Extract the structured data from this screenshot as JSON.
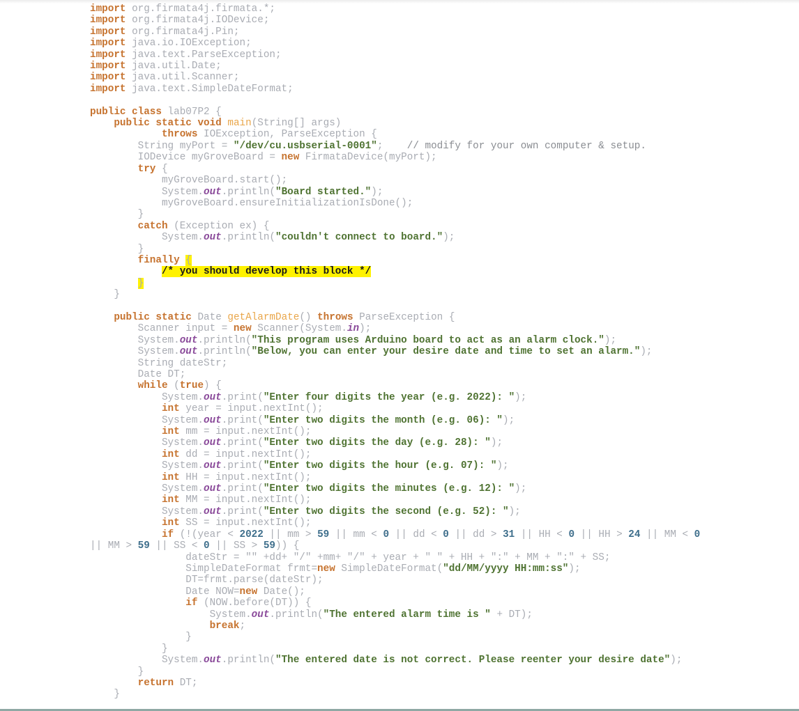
{
  "document": {
    "language": "java",
    "class_name": "lab07P2",
    "highlight_color": "#fff200",
    "colors": {
      "keyword": "#c6732f",
      "string": "#4f7332",
      "number": "#3f6f8c",
      "method_decl": "#e9a64a",
      "static_field": "#8a4a9a",
      "plain": "#a9acb3"
    }
  },
  "lines": [
    [
      [
        "kw",
        "import"
      ],
      [
        "p",
        " org.firmata4j.firmata.*;"
      ]
    ],
    [
      [
        "kw",
        "import"
      ],
      [
        "p",
        " org.firmata4j.IODevice;"
      ]
    ],
    [
      [
        "kw",
        "import"
      ],
      [
        "p",
        " org.firmata4j.Pin;"
      ]
    ],
    [
      [
        "kw",
        "import"
      ],
      [
        "p",
        " java.io.IOException;"
      ]
    ],
    [
      [
        "kw",
        "import"
      ],
      [
        "p",
        " java.text.ParseException;"
      ]
    ],
    [
      [
        "kw",
        "import"
      ],
      [
        "p",
        " java.util.Date;"
      ]
    ],
    [
      [
        "kw",
        "import"
      ],
      [
        "p",
        " java.util.Scanner;"
      ]
    ],
    [
      [
        "kw",
        "import"
      ],
      [
        "p",
        " java.text.SimpleDateFormat;"
      ]
    ],
    [],
    [
      [
        "kw",
        "public class"
      ],
      [
        "p",
        " lab07P2 {"
      ]
    ],
    [
      [
        "p",
        "    "
      ],
      [
        "kw",
        "public static void"
      ],
      [
        "p",
        " "
      ],
      [
        "fn",
        "main"
      ],
      [
        "p",
        "(String[] args)"
      ]
    ],
    [
      [
        "p",
        "            "
      ],
      [
        "kw",
        "throws"
      ],
      [
        "p",
        " IOException, ParseException {"
      ]
    ],
    [
      [
        "p",
        "        String myPort = "
      ],
      [
        "str",
        "\"/dev/cu.usbserial-0001\""
      ],
      [
        "p",
        ";    "
      ],
      [
        "cm",
        "// modify for your own computer & setup."
      ]
    ],
    [
      [
        "p",
        "        IODevice myGroveBoard = "
      ],
      [
        "kw",
        "new"
      ],
      [
        "p",
        " FirmataDevice(myPort);"
      ]
    ],
    [
      [
        "p",
        "        "
      ],
      [
        "kw",
        "try"
      ],
      [
        "p",
        " {"
      ]
    ],
    [
      [
        "p",
        "            myGroveBoard.start();"
      ]
    ],
    [
      [
        "p",
        "            System."
      ],
      [
        "field",
        "out"
      ],
      [
        "p",
        ".println("
      ],
      [
        "str",
        "\"Board started.\""
      ],
      [
        "p",
        ");"
      ]
    ],
    [
      [
        "p",
        "            myGroveBoard.ensureInitializationIsDone();"
      ]
    ],
    [
      [
        "p",
        "        }"
      ]
    ],
    [
      [
        "p",
        "        "
      ],
      [
        "kw",
        "catch"
      ],
      [
        "p",
        " (Exception ex) {"
      ]
    ],
    [
      [
        "p",
        "            System."
      ],
      [
        "field",
        "out"
      ],
      [
        "p",
        ".println("
      ],
      [
        "str",
        "\"couldn't connect to board.\""
      ],
      [
        "p",
        ");"
      ]
    ],
    [
      [
        "p",
        "        }"
      ]
    ],
    [
      [
        "p",
        "        "
      ],
      [
        "kw",
        "finally"
      ],
      [
        "p",
        " "
      ],
      [
        "hl",
        "{"
      ]
    ],
    [
      [
        "p",
        "            "
      ],
      [
        "hlcm",
        "/* you should develop this block */"
      ]
    ],
    [
      [
        "p",
        "        "
      ],
      [
        "hl",
        "}"
      ]
    ],
    [
      [
        "p",
        "    }"
      ]
    ],
    [],
    [
      [
        "p",
        "    "
      ],
      [
        "kw",
        "public static"
      ],
      [
        "p",
        " Date "
      ],
      [
        "fn",
        "getAlarmDate"
      ],
      [
        "p",
        "() "
      ],
      [
        "kw",
        "throws"
      ],
      [
        "p",
        " ParseException {"
      ]
    ],
    [
      [
        "p",
        "        Scanner input = "
      ],
      [
        "kw",
        "new"
      ],
      [
        "p",
        " Scanner(System."
      ],
      [
        "field",
        "in"
      ],
      [
        "p",
        ");"
      ]
    ],
    [
      [
        "p",
        "        System."
      ],
      [
        "field",
        "out"
      ],
      [
        "p",
        ".println("
      ],
      [
        "str",
        "\"This program uses Arduino board to act as an alarm clock.\""
      ],
      [
        "p",
        ");"
      ]
    ],
    [
      [
        "p",
        "        System."
      ],
      [
        "field",
        "out"
      ],
      [
        "p",
        ".println("
      ],
      [
        "str",
        "\"Below, you can enter your desire date and time to set an alarm.\""
      ],
      [
        "p",
        ");"
      ]
    ],
    [
      [
        "p",
        "        String dateStr;"
      ]
    ],
    [
      [
        "p",
        "        Date DT;"
      ]
    ],
    [
      [
        "p",
        "        "
      ],
      [
        "kw",
        "while"
      ],
      [
        "p",
        " ("
      ],
      [
        "kw",
        "true"
      ],
      [
        "p",
        ") {"
      ]
    ],
    [
      [
        "p",
        "            System."
      ],
      [
        "field",
        "out"
      ],
      [
        "p",
        ".print("
      ],
      [
        "str",
        "\"Enter four digits the year (e.g. 2022): \""
      ],
      [
        "p",
        ");"
      ]
    ],
    [
      [
        "p",
        "            "
      ],
      [
        "kw",
        "int"
      ],
      [
        "p",
        " year = input.nextInt();"
      ]
    ],
    [
      [
        "p",
        "            System."
      ],
      [
        "field",
        "out"
      ],
      [
        "p",
        ".print("
      ],
      [
        "str",
        "\"Enter two digits the month (e.g. 06): \""
      ],
      [
        "p",
        ");"
      ]
    ],
    [
      [
        "p",
        "            "
      ],
      [
        "kw",
        "int"
      ],
      [
        "p",
        " mm = input.nextInt();"
      ]
    ],
    [
      [
        "p",
        "            System."
      ],
      [
        "field",
        "out"
      ],
      [
        "p",
        ".print("
      ],
      [
        "str",
        "\"Enter two digits the day (e.g. 28): \""
      ],
      [
        "p",
        ");"
      ]
    ],
    [
      [
        "p",
        "            "
      ],
      [
        "kw",
        "int"
      ],
      [
        "p",
        " dd = input.nextInt();"
      ]
    ],
    [
      [
        "p",
        "            System."
      ],
      [
        "field",
        "out"
      ],
      [
        "p",
        ".print("
      ],
      [
        "str",
        "\"Enter two digits the hour (e.g. 07): \""
      ],
      [
        "p",
        ");"
      ]
    ],
    [
      [
        "p",
        "            "
      ],
      [
        "kw",
        "int"
      ],
      [
        "p",
        " HH = input.nextInt();"
      ]
    ],
    [
      [
        "p",
        "            System."
      ],
      [
        "field",
        "out"
      ],
      [
        "p",
        ".print("
      ],
      [
        "str",
        "\"Enter two digits the minutes (e.g. 12): \""
      ],
      [
        "p",
        ");"
      ]
    ],
    [
      [
        "p",
        "            "
      ],
      [
        "kw",
        "int"
      ],
      [
        "p",
        " MM = input.nextInt();"
      ]
    ],
    [
      [
        "p",
        "            System."
      ],
      [
        "field",
        "out"
      ],
      [
        "p",
        ".print("
      ],
      [
        "str",
        "\"Enter two digits the second (e.g. 52): \""
      ],
      [
        "p",
        ");"
      ]
    ],
    [
      [
        "p",
        "            "
      ],
      [
        "kw",
        "int"
      ],
      [
        "p",
        " SS = input.nextInt();"
      ]
    ],
    [
      [
        "p",
        "            "
      ],
      [
        "kw",
        "if"
      ],
      [
        "p",
        " (!(year < "
      ],
      [
        "num",
        "2022"
      ],
      [
        "p",
        " || mm > "
      ],
      [
        "num",
        "59"
      ],
      [
        "p",
        " || mm < "
      ],
      [
        "num",
        "0"
      ],
      [
        "p",
        " || dd < "
      ],
      [
        "num",
        "0"
      ],
      [
        "p",
        " || dd > "
      ],
      [
        "num",
        "31"
      ],
      [
        "p",
        " || HH < "
      ],
      [
        "num",
        "0"
      ],
      [
        "p",
        " || HH > "
      ],
      [
        "num",
        "24"
      ],
      [
        "p",
        " || MM < "
      ],
      [
        "num",
        "0"
      ]
    ],
    [
      [
        "p",
        "|| MM > "
      ],
      [
        "num",
        "59"
      ],
      [
        "p",
        " || SS < "
      ],
      [
        "num",
        "0"
      ],
      [
        "p",
        " || SS > "
      ],
      [
        "num",
        "59"
      ],
      [
        "p",
        ")) {"
      ]
    ],
    [
      [
        "p",
        "                dateStr = \"\" +dd+ \"/\" +mm+ \"/\" + year + \" \" + HH + \":\" + MM + \":\" + SS;"
      ]
    ],
    [
      [
        "p",
        "                SimpleDateFormat frmt="
      ],
      [
        "kw",
        "new"
      ],
      [
        "p",
        " SimpleDateFormat("
      ],
      [
        "str",
        "\"dd/MM/yyyy HH:mm:ss\""
      ],
      [
        "p",
        ");"
      ]
    ],
    [
      [
        "p",
        "                DT=frmt.parse(dateStr);"
      ]
    ],
    [
      [
        "p",
        "                Date NOW="
      ],
      [
        "kw",
        "new"
      ],
      [
        "p",
        " Date();"
      ]
    ],
    [
      [
        "p",
        "                "
      ],
      [
        "kw",
        "if"
      ],
      [
        "p",
        " (NOW.before(DT)) {"
      ]
    ],
    [
      [
        "p",
        "                    System."
      ],
      [
        "field",
        "out"
      ],
      [
        "p",
        ".println("
      ],
      [
        "str",
        "\"The entered alarm time is \""
      ],
      [
        "p",
        " + DT);"
      ]
    ],
    [
      [
        "p",
        "                    "
      ],
      [
        "kw",
        "break"
      ],
      [
        "p",
        ";"
      ]
    ],
    [
      [
        "p",
        "                }"
      ]
    ],
    [
      [
        "p",
        "            }"
      ]
    ],
    [
      [
        "p",
        "            System."
      ],
      [
        "field",
        "out"
      ],
      [
        "p",
        ".println("
      ],
      [
        "str",
        "\"The entered date is not correct. Please reenter your desire date\""
      ],
      [
        "p",
        ");"
      ]
    ],
    [
      [
        "p",
        "        }"
      ]
    ],
    [
      [
        "p",
        "        "
      ],
      [
        "kw",
        "return"
      ],
      [
        "p",
        " DT;"
      ]
    ],
    [
      [
        "p",
        "    }"
      ]
    ]
  ]
}
